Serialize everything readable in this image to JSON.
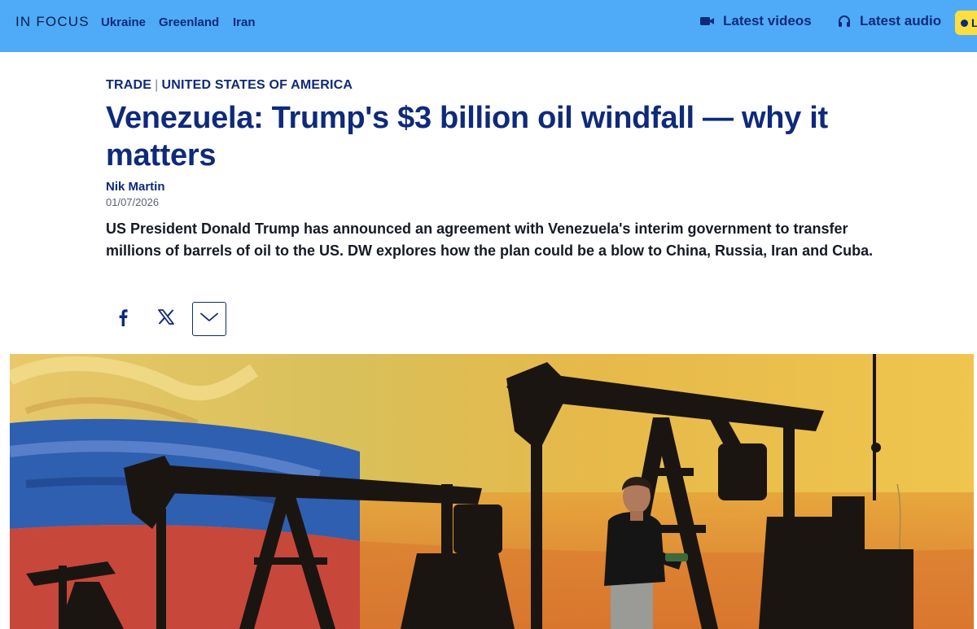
{
  "topbar": {
    "section_label": "IN FOCUS",
    "topics": [
      "Ukraine",
      "Greenland",
      "Iran"
    ],
    "latest_videos": "Latest videos",
    "latest_audio": "Latest audio",
    "live_label": "L",
    "icons": {
      "videos": "video-camera-icon",
      "audio": "headphones-icon"
    }
  },
  "article": {
    "kicker_category": "TRADE",
    "kicker_separator": "|",
    "kicker_region": "UNITED STATES OF AMERICA",
    "headline": "Venezuela: Trump's $3 billion oil windfall — why it matters",
    "author": "Nik Martin",
    "date": "01/07/2026",
    "teaser": "US President Donald Trump has announced an agreement with Venezuela's interim government to transfer millions of barrels of oil to the US. DW explores how the plan could be a blow to China, Russia, Iran and Cuba."
  },
  "share": {
    "buttons": [
      "facebook-icon",
      "x-icon",
      "chevron-down-icon"
    ]
  },
  "colors": {
    "topbar_bg": "#4fabf7",
    "brand_navy": "#0e2a7a",
    "live_yellow": "#ffdf3d"
  }
}
